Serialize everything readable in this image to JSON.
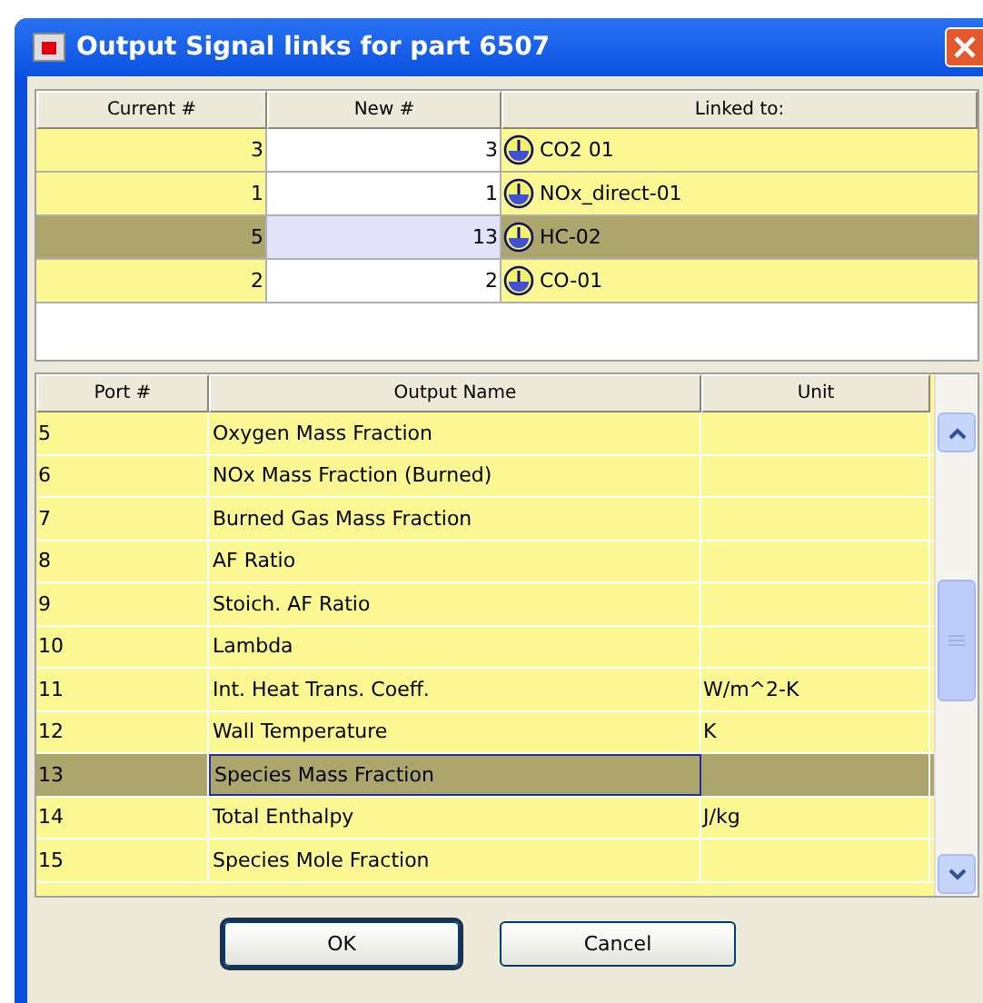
{
  "window": {
    "title": "Output Signal links for part 6507"
  },
  "links_table": {
    "columns": [
      "Current #",
      "New #",
      "Linked to:"
    ],
    "rows": [
      {
        "current": "3",
        "new": "3",
        "linked_to": "CO2 01",
        "selected": false
      },
      {
        "current": "1",
        "new": "1",
        "linked_to": "NOx_direct-01",
        "selected": false
      },
      {
        "current": "5",
        "new": "13",
        "linked_to": "HC-02",
        "selected": true
      },
      {
        "current": "2",
        "new": "2",
        "linked_to": "CO-01",
        "selected": false
      }
    ]
  },
  "outputs_table": {
    "columns": [
      "Port #",
      "Output Name",
      "Unit"
    ],
    "rows": [
      {
        "port": "5",
        "name": "Oxygen Mass Fraction",
        "unit": "",
        "selected": false
      },
      {
        "port": "6",
        "name": "NOx Mass Fraction (Burned)",
        "unit": "",
        "selected": false
      },
      {
        "port": "7",
        "name": "Burned Gas Mass Fraction",
        "unit": "",
        "selected": false
      },
      {
        "port": "8",
        "name": "AF Ratio",
        "unit": "",
        "selected": false
      },
      {
        "port": "9",
        "name": "Stoich. AF Ratio",
        "unit": "",
        "selected": false
      },
      {
        "port": "10",
        "name": "Lambda",
        "unit": "",
        "selected": false
      },
      {
        "port": "11",
        "name": "Int. Heat Trans. Coeff.",
        "unit": "W/m^2-K",
        "selected": false
      },
      {
        "port": "12",
        "name": "Wall Temperature",
        "unit": "K",
        "selected": false
      },
      {
        "port": "13",
        "name": "Species Mass Fraction",
        "unit": "",
        "selected": true
      },
      {
        "port": "14",
        "name": "Total Enthalpy",
        "unit": "J/kg",
        "selected": false
      },
      {
        "port": "15",
        "name": "Species Mole Fraction",
        "unit": "",
        "selected": false
      }
    ]
  },
  "buttons": [
    {
      "label": "OK",
      "default": true
    },
    {
      "label": "Cancel",
      "default": false
    }
  ]
}
